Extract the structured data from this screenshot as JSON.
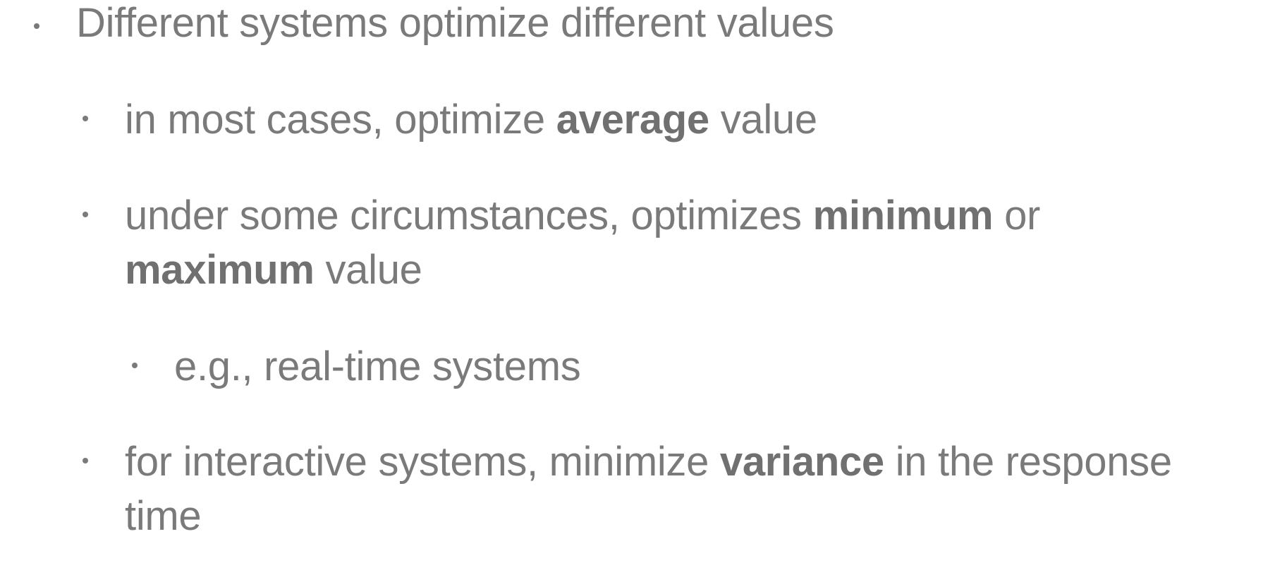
{
  "bullets": [
    {
      "level": 1,
      "text": "Different systems optimize different values"
    },
    {
      "level": 2,
      "before": "in most cases, optimize ",
      "bold": "average",
      "after": " value"
    },
    {
      "level": 2,
      "before": "under some circumstances, optimizes ",
      "bold": "minimum",
      "mid": " or",
      "bold2": "maximum",
      "after": " value"
    },
    {
      "level": 3,
      "text": "e.g., real-time systems"
    },
    {
      "level": 2,
      "before": "for interactive systems, minimize ",
      "bold": "variance",
      "after": " in the response",
      "line2": "time"
    }
  ]
}
